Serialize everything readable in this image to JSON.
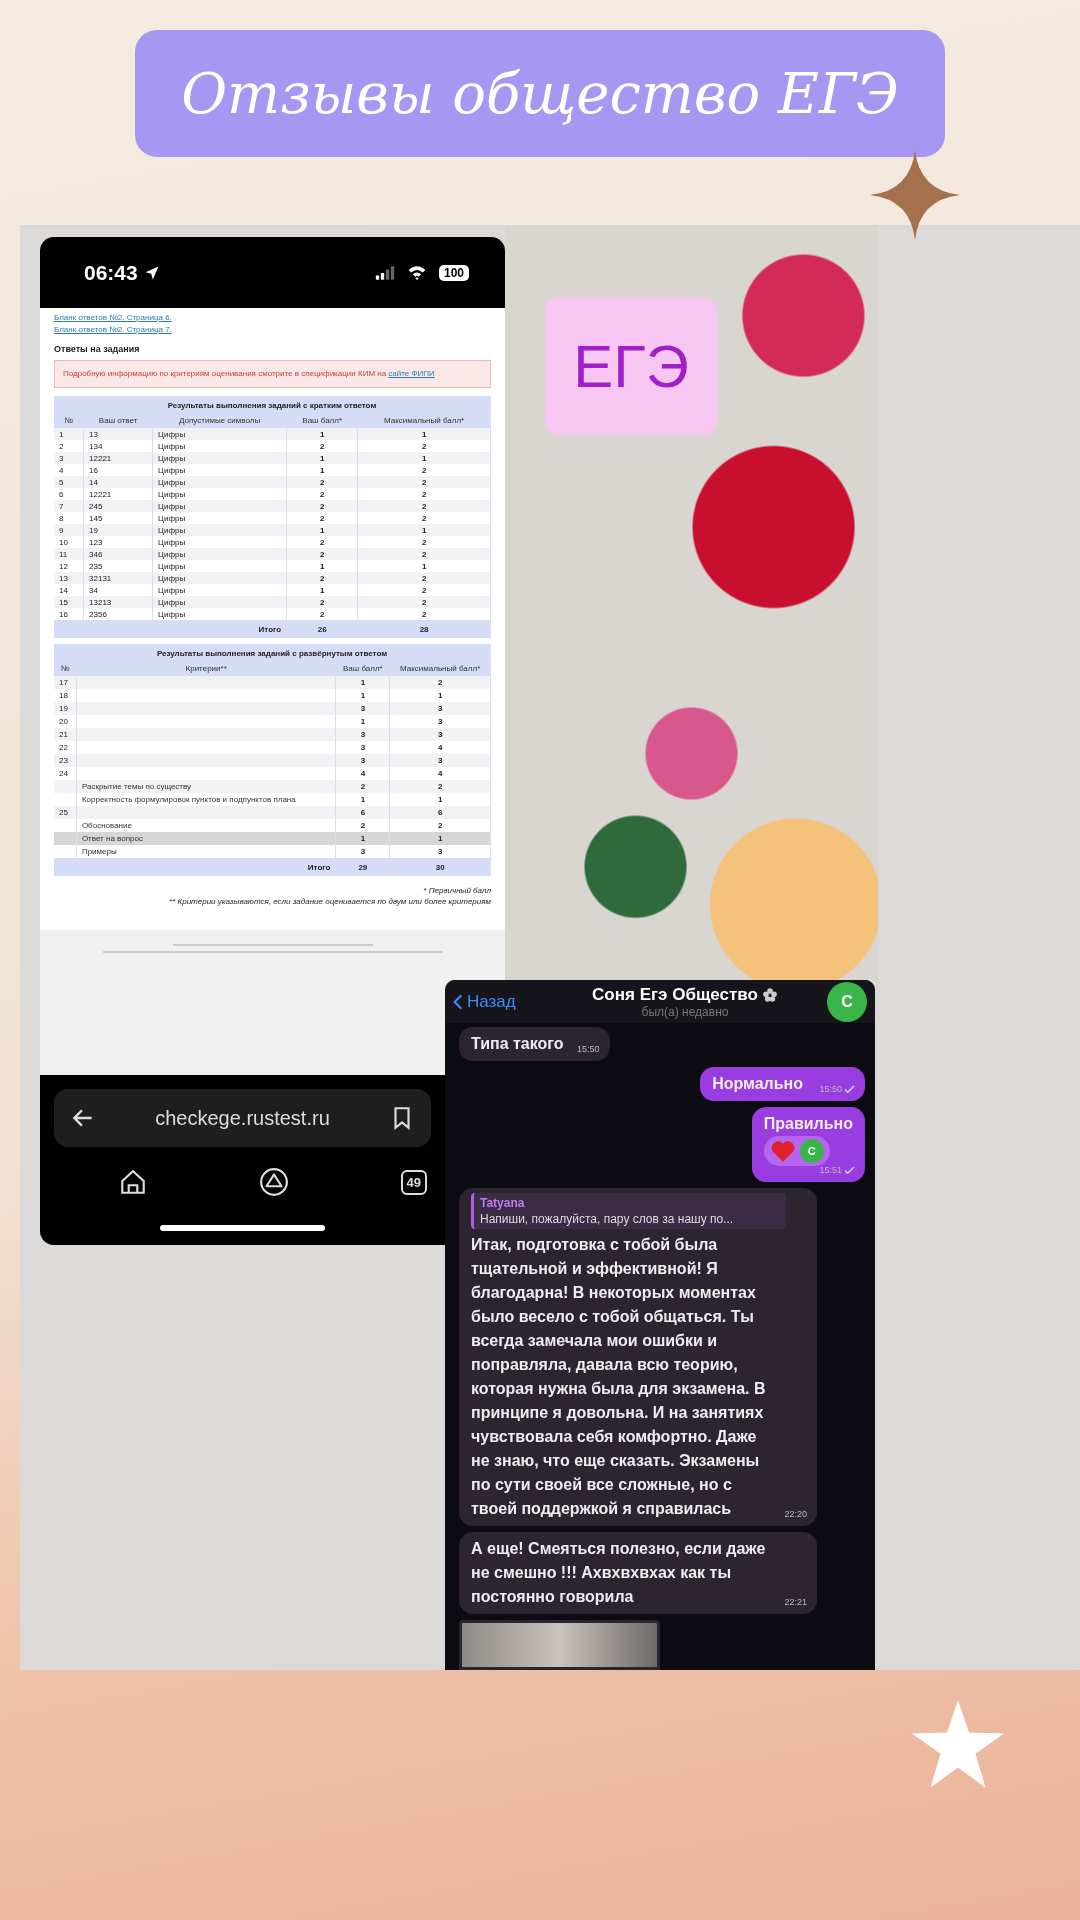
{
  "title": "Отзывы общество ЕГЭ",
  "phone": {
    "status_bar": {
      "time": "06:43",
      "battery": "100"
    },
    "page": {
      "links": [
        "Бланк ответов №2. Страница 6.",
        "Бланк ответов №2. Страница 7."
      ],
      "heading": "Ответы на задания",
      "notice": {
        "text": "Подробную информацию по критериям оценивания смотрите в спецификации КИМ на",
        "link": "сайте ФИПИ"
      },
      "short_table": {
        "title": "Результаты выполнения заданий с кратким ответом",
        "columns": [
          "№",
          "Ваш ответ",
          "Допустимые символы",
          "Ваш балл*",
          "Максимальный балл*"
        ],
        "rows": [
          [
            "1",
            "13",
            "Цифры",
            "1",
            "1"
          ],
          [
            "2",
            "134",
            "Цифры",
            "2",
            "2"
          ],
          [
            "3",
            "12221",
            "Цифры",
            "1",
            "1"
          ],
          [
            "4",
            "16",
            "Цифры",
            "1",
            "2"
          ],
          [
            "5",
            "14",
            "Цифры",
            "2",
            "2"
          ],
          [
            "6",
            "12221",
            "Цифры",
            "2",
            "2"
          ],
          [
            "7",
            "245",
            "Цифры",
            "2",
            "2"
          ],
          [
            "8",
            "145",
            "Цифры",
            "2",
            "2"
          ],
          [
            "9",
            "19",
            "Цифры",
            "1",
            "1"
          ],
          [
            "10",
            "123",
            "Цифры",
            "2",
            "2"
          ],
          [
            "11",
            "346",
            "Цифры",
            "2",
            "2"
          ],
          [
            "12",
            "235",
            "Цифры",
            "1",
            "1"
          ],
          [
            "13",
            "32131",
            "Цифры",
            "2",
            "2"
          ],
          [
            "14",
            "34",
            "Цифры",
            "1",
            "2"
          ],
          [
            "15",
            "13213",
            "Цифры",
            "2",
            "2"
          ],
          [
            "16",
            "2356",
            "Цифры",
            "2",
            "2"
          ]
        ],
        "total": {
          "label": "Итого",
          "score": "26",
          "max": "28"
        }
      },
      "long_table": {
        "title": "Результаты выполнения заданий с развёрнутым ответом",
        "columns": [
          "№",
          "Критерии**",
          "Ваш балл*",
          "Максимальный балл*"
        ],
        "rows": [
          {
            "num": "17",
            "criterion": "",
            "score": "1",
            "max": "2",
            "highlighted": false
          },
          {
            "num": "18",
            "criterion": "",
            "score": "1",
            "max": "1",
            "highlighted": false
          },
          {
            "num": "19",
            "criterion": "",
            "score": "3",
            "max": "3",
            "highlighted": false
          },
          {
            "num": "20",
            "criterion": "",
            "score": "1",
            "max": "3",
            "highlighted": false
          },
          {
            "num": "21",
            "criterion": "",
            "score": "3",
            "max": "3",
            "highlighted": false
          },
          {
            "num": "22",
            "criterion": "",
            "score": "3",
            "max": "4",
            "highlighted": false
          },
          {
            "num": "23",
            "criterion": "",
            "score": "3",
            "max": "3",
            "highlighted": false
          },
          {
            "num": "24",
            "criterion": "",
            "score": "4",
            "max": "4",
            "highlighted": false
          },
          {
            "num": "",
            "criterion": "Раскрытие темы по существу",
            "score": "2",
            "max": "2",
            "highlighted": false
          },
          {
            "num": "",
            "criterion": "Корректность формулировок пунктов и подпунктов плана",
            "score": "1",
            "max": "1",
            "highlighted": false
          },
          {
            "num": "25",
            "criterion": "",
            "score": "6",
            "max": "6",
            "highlighted": false
          },
          {
            "num": "",
            "criterion": "Обоснование",
            "score": "2",
            "max": "2",
            "highlighted": false
          },
          {
            "num": "",
            "criterion": "Ответ на вопрос",
            "score": "1",
            "max": "1",
            "highlighted": true
          },
          {
            "num": "",
            "criterion": "Примеры",
            "score": "3",
            "max": "3",
            "highlighted": false
          }
        ],
        "total": {
          "label": "Итого",
          "score": "29",
          "max": "30"
        }
      },
      "footnotes": [
        "* Первичный балл",
        "** Критерии указываются, если задание оценивается по двум или более критериям"
      ]
    },
    "browser": {
      "url": "checkege.rustest.ru",
      "tabs_count": "49"
    }
  },
  "badge": "ЕГЭ",
  "chat": {
    "back": "Назад",
    "name": "Соня Егэ Общество",
    "status": "был(а) недавно",
    "avatar": "С",
    "messages": [
      {
        "kind": "text",
        "outgoing": false,
        "text": "Типа такого",
        "time": "15:50"
      },
      {
        "kind": "text",
        "outgoing": true,
        "text": "Нормально",
        "time": "15:50"
      },
      {
        "kind": "reaction",
        "outgoing": true,
        "text": "Правильно",
        "time": "15:51",
        "reaction_avatar": "С"
      },
      {
        "kind": "reply",
        "outgoing": false,
        "reply_to": {
          "author": "Tatyana",
          "text": "Напиши, пожалуйста, пару слов за нашу по..."
        },
        "text": "Итак, подготовка с тобой была тщательной и эффективной! Я благодарна! В некоторых моментах было весело с тобой общаться. Ты всегда замечала мои ошибки и поправляла, давала всю теорию, которая нужна была для экзамена. В принципе я довольна. И на занятиях чувствовала себя комфортно. Даже не знаю, что еще сказать. Экзамены по сути своей все сложные, но с твоей поддержкой я справилась",
        "time": "22:20"
      },
      {
        "kind": "text",
        "outgoing": false,
        "text": "А еще! Смеяться полезно, если даже не смешно !!! Ахвхвхвхах как ты постоянно говорила",
        "time": "22:21"
      },
      {
        "kind": "photo",
        "outgoing": false
      }
    ]
  }
}
